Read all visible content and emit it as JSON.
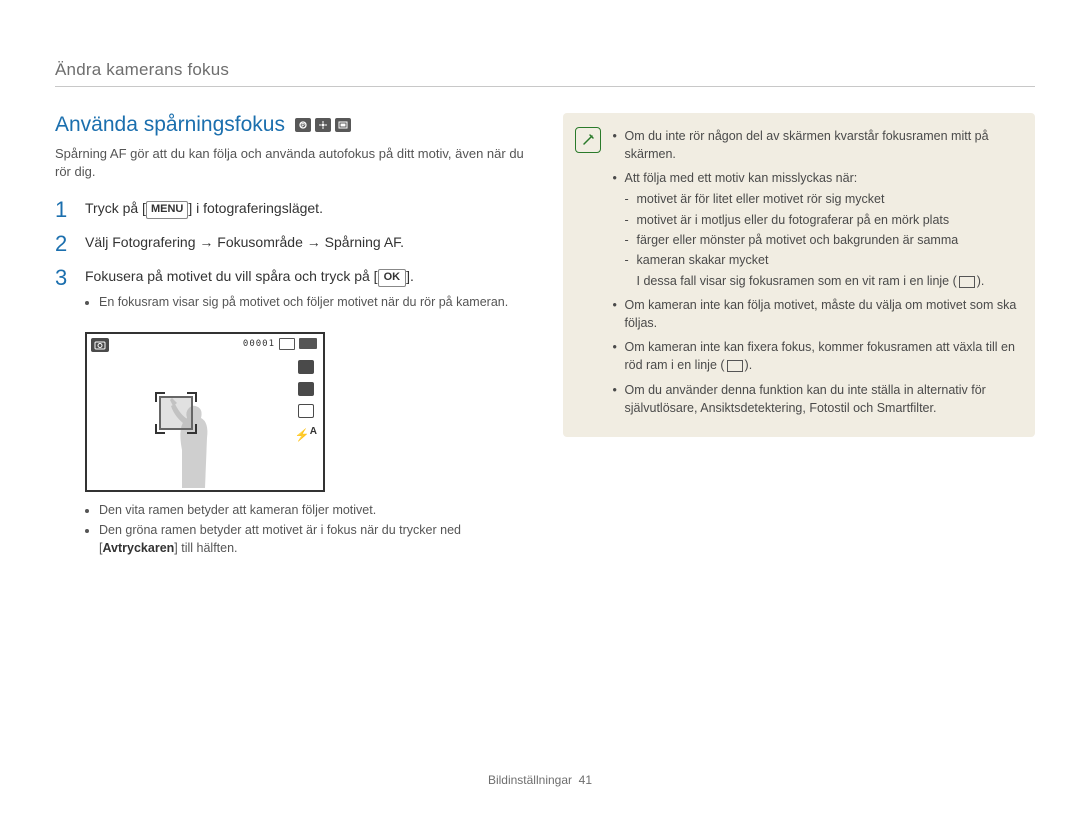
{
  "header": {
    "breadcrumb": "Ändra kamerans fokus"
  },
  "section": {
    "heading": "Använda spårningsfokus",
    "mode_icons": [
      "p-mode-icon",
      "dual-is-icon",
      "scene-icon"
    ],
    "intro": "Spårning AF gör att du kan följa och använda autofokus på ditt motiv, även när du rör dig."
  },
  "steps": [
    {
      "num": "1",
      "pre": "Tryck på [",
      "label": "MENU",
      "post": "] i fotograferingsläget."
    },
    {
      "num": "2",
      "text": "Välj Fotografering → Fokusområde → Spårning AF."
    },
    {
      "num": "3",
      "pre": "Fokusera på motivet du vill spåra och tryck på [",
      "label": "OK",
      "post": "].",
      "sub": [
        "En fokusram visar sig på motivet och följer motivet när du rör på kameran."
      ]
    }
  ],
  "camera_screen": {
    "counter": "00001",
    "flash": "A"
  },
  "post_image_bullets": [
    "Den vita ramen betyder att kameran följer motivet.",
    {
      "pre": "Den gröna ramen betyder att motivet är i fokus när du trycker ned [",
      "bold": "Avtryckaren",
      "post": "] till hälften."
    }
  ],
  "note": {
    "items": [
      "Om du inte rör någon del av skärmen kvarstår fokusramen mitt på skärmen.",
      {
        "text": "Att följa med ett motiv kan misslyckas när:",
        "sub": [
          "motivet är för litet eller motivet rör sig mycket",
          "motivet är i motljus eller du fotograferar på en mörk plats",
          "färger eller mönster på motivet och bakgrunden är samma",
          "kameran skakar mycket"
        ],
        "after": "I dessa fall visar sig fokusramen som en vit ram i en linje ("
      },
      "Om kameran inte kan följa motivet, måste du välja om motivet som ska följas.",
      {
        "text_pre": "Om kameran inte kan fixera fokus, kommer fokusramen att växla till en röd ram i en linje (",
        "text_post": ")."
      },
      "Om du använder denna funktion kan du inte ställa in alternativ för självutlösare, Ansiktsdetektering, Fotostil och Smartfilter."
    ]
  },
  "footer": {
    "section": "Bildinställningar",
    "page": "41"
  }
}
